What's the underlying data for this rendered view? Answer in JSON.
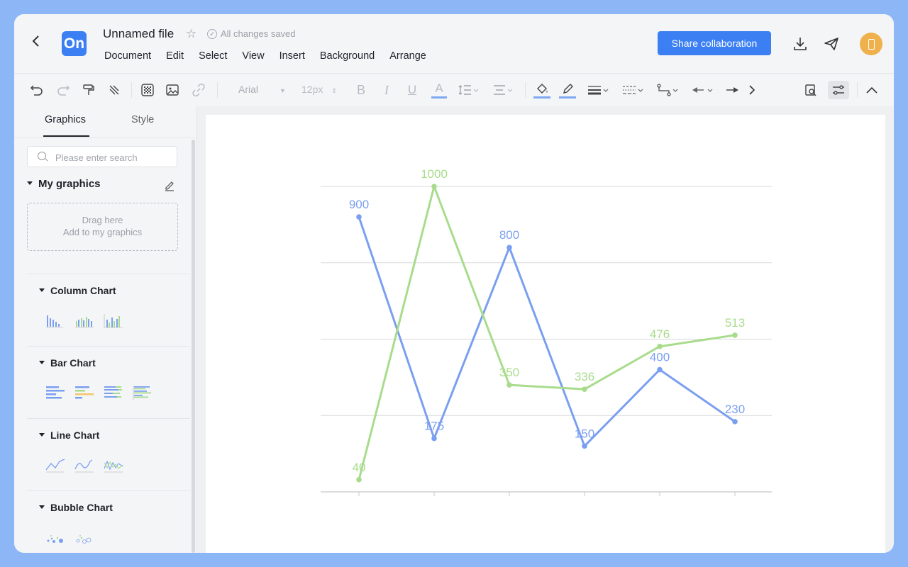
{
  "header": {
    "title": "Unnamed file",
    "save_status": "All changes saved",
    "logo_text": "On",
    "share_label": "Share collaboration",
    "menu": [
      "Document",
      "Edit",
      "Select",
      "View",
      "Insert",
      "Background",
      "Arrange"
    ]
  },
  "toolbar": {
    "font": "Arial",
    "font_size": "12px"
  },
  "sidebar": {
    "tabs": [
      "Graphics",
      "Style"
    ],
    "search_placeholder": "Please enter search",
    "my_graphics": "My graphics",
    "drop_line1": "Drag here",
    "drop_line2": "Add to my graphics",
    "sections": [
      "Column Chart",
      "Bar Chart",
      "Line Chart",
      "Bubble Chart"
    ]
  },
  "colors": {
    "accent": "#3b7ff3",
    "series_blue": "#7b9ff0",
    "series_green": "#a8dc8c",
    "avatar": "#eeb14b"
  },
  "chart_data": {
    "type": "line",
    "categories": [
      "",
      "",
      "",
      "",
      "",
      ""
    ],
    "series": [
      {
        "color": "#7b9ff0",
        "values": [
          900,
          175,
          800,
          150,
          400,
          230
        ]
      },
      {
        "color": "#a8dc8c",
        "values": [
          40,
          1000,
          350,
          336,
          476,
          513
        ]
      }
    ],
    "ylim": [
      0,
      1000
    ],
    "grid": true,
    "data_labels": true
  }
}
